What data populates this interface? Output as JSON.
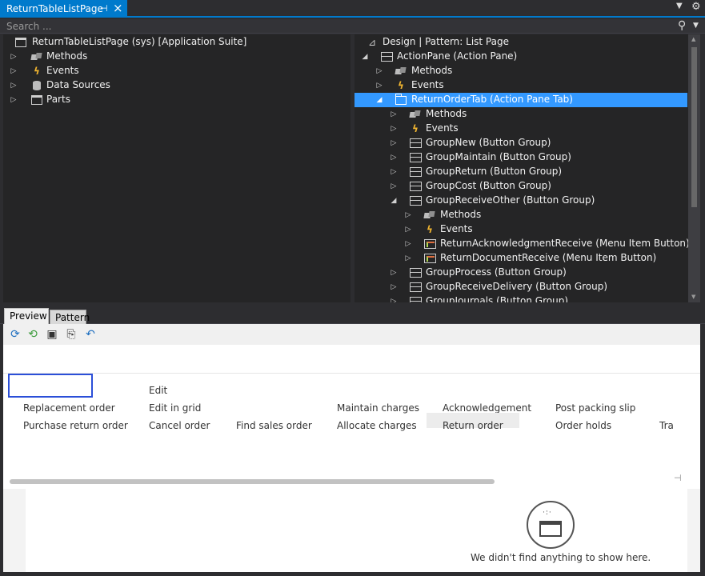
{
  "tab": {
    "title": "ReturnTableListPage",
    "pin_icon": "pin-icon",
    "close_icon": "close-icon",
    "menu_icon": "dropdown-icon",
    "gear_icon": "gear-icon"
  },
  "search": {
    "placeholder": "Search ..."
  },
  "left_tree": {
    "root": "ReturnTableListPage (sys) [Application Suite]",
    "items": [
      {
        "label": "Methods",
        "icon": "methods-icon"
      },
      {
        "label": "Events",
        "icon": "events-icon"
      },
      {
        "label": "Data Sources",
        "icon": "data-sources-icon"
      },
      {
        "label": "Parts",
        "icon": "parts-icon"
      }
    ]
  },
  "right_tree": {
    "root": "Design | Pattern: List Page",
    "action_pane": "ActionPane (Action Pane)",
    "ap_methods": "Methods",
    "ap_events": "Events",
    "selected": "ReturnOrderTab (Action Pane Tab)",
    "tab_methods": "Methods",
    "tab_events": "Events",
    "groups": [
      "GroupNew (Button Group)",
      "GroupMaintain (Button Group)",
      "GroupReturn (Button Group)",
      "GroupCost (Button Group)",
      "GroupReceiveOther (Button Group)"
    ],
    "gro_methods": "Methods",
    "gro_events": "Events",
    "gro_items": [
      "ReturnAcknowledgmentReceive (Menu Item Button)",
      "ReturnDocumentReceive (Menu Item Button)"
    ],
    "more_groups": [
      "GroupProcess (Button Group)",
      "GroupReceiveDelivery (Button Group)",
      "GroupJournals (Button Group)"
    ]
  },
  "bottom_tabs": {
    "preview": "Preview",
    "pattern": "Pattern"
  },
  "preview": {
    "actions": {
      "edit": "Edit",
      "replacement_order": "Replacement order",
      "edit_in_grid": "Edit in grid",
      "maintain_charges": "Maintain charges",
      "acknowledgement": "Acknowledgement",
      "post_packing_slip": "Post packing slip",
      "purchase_return_order": "Purchase return order",
      "cancel_order": "Cancel order",
      "find_sales_order": "Find sales order",
      "allocate_charges": "Allocate charges",
      "return_order": "Return order",
      "order_holds": "Order holds",
      "truncated": "Tra"
    }
  },
  "empty_state": {
    "message": "We didn't find anything to show here."
  }
}
